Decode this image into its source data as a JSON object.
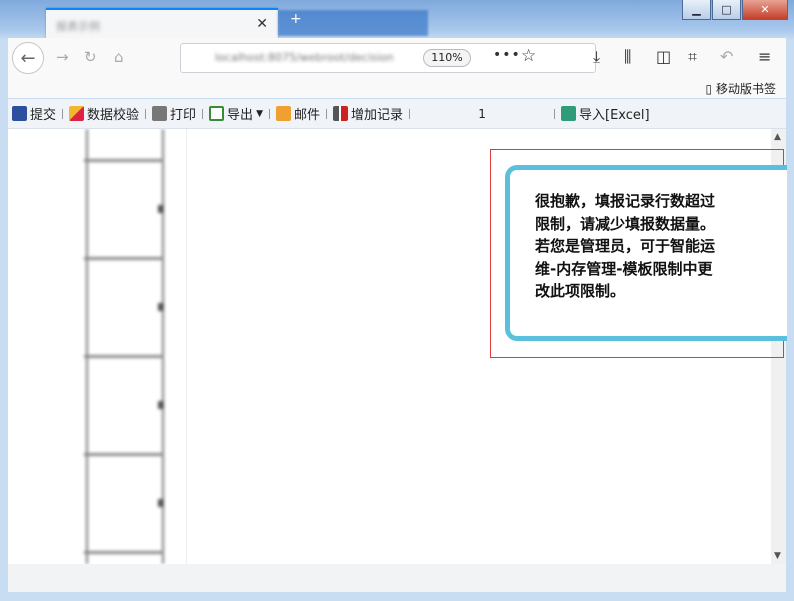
{
  "window": {
    "tab_title": "报表示例",
    "tab_close": "✕",
    "url": "localhost:8075/webroot/decision",
    "zoom": "110%",
    "min_label": "▁",
    "max_label": "□",
    "close_label": "✕"
  },
  "bookmarks": {
    "mobile": "移动版书签"
  },
  "toolbar": {
    "submit": "提交",
    "validate": "数据校验",
    "print": "打印",
    "export": "导出",
    "email": "邮件",
    "add_record": "增加记录",
    "record_count": "1",
    "import_excel": "导入[Excel]"
  },
  "alert": {
    "message": "很抱歉，填报记录行数超过限制，请减少填报数据量。若您是管理员，可于智能运维-内存管理-模板限制中更改此项限制。"
  },
  "colors": {
    "accent_tab": "#0a84ff",
    "alert_border": "#5bc0de",
    "highlight_outline": "#e0393e"
  }
}
